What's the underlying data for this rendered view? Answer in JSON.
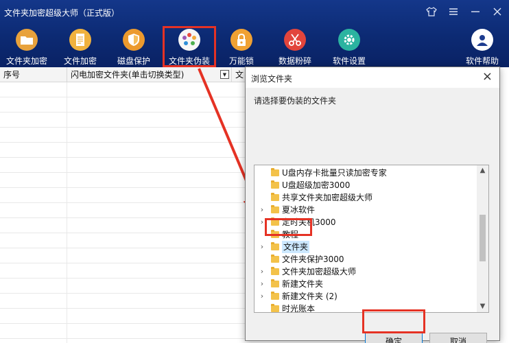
{
  "app": {
    "title": "文件夹加密超级大师（正式版）",
    "controls": [
      "shirt-icon",
      "menu-icon",
      "minimize-icon",
      "close-icon"
    ]
  },
  "toolbar": {
    "items": [
      {
        "label": "文件夹加密",
        "icon": "folder-icon",
        "color": "#e8a23c"
      },
      {
        "label": "文件加密",
        "icon": "document-icon",
        "color": "#f0b23e"
      },
      {
        "label": "磁盘保护",
        "icon": "shield-icon",
        "color": "#ec9a2e"
      },
      {
        "label": "文件夹伪装",
        "icon": "camouflage-icon",
        "color": "#f6f6f6"
      },
      {
        "label": "万能锁",
        "icon": "lock-icon",
        "color": "#f0a133"
      },
      {
        "label": "数据粉碎",
        "icon": "scissors-icon",
        "color": "#e2453c"
      },
      {
        "label": "软件设置",
        "icon": "gear-icon",
        "color": "#2bb3a0"
      },
      {
        "label": "软件帮助",
        "icon": "user-help-icon",
        "color": "#ffffff"
      }
    ],
    "highlight_color": "#e53224"
  },
  "table": {
    "columns": [
      "序号",
      "闪电加密文件夹(单击切换类型)",
      "文"
    ],
    "dropdown_icon": "dropdown-arrow-icon"
  },
  "dialog": {
    "title": "浏览文件夹",
    "prompt": "请选择要伪装的文件夹",
    "items": [
      {
        "label": "U盘内存卡批量只读加密专家",
        "expandable": false
      },
      {
        "label": "U盘超级加密3000",
        "expandable": false
      },
      {
        "label": "共享文件夹加密超级大师",
        "expandable": false
      },
      {
        "label": "夏冰软件",
        "expandable": true
      },
      {
        "label": "定时关机3000",
        "expandable": true
      },
      {
        "label": "教程",
        "expandable": false
      },
      {
        "label": "文件夹",
        "expandable": true,
        "selected": true
      },
      {
        "label": "文件夹保护3000",
        "expandable": false
      },
      {
        "label": "文件夹加密超级大师",
        "expandable": true
      },
      {
        "label": "新建文件夹",
        "expandable": true
      },
      {
        "label": "新建文件夹 (2)",
        "expandable": true
      },
      {
        "label": "时光账本",
        "expandable": false
      }
    ],
    "ok_label": "确定",
    "cancel_label": "取消"
  }
}
